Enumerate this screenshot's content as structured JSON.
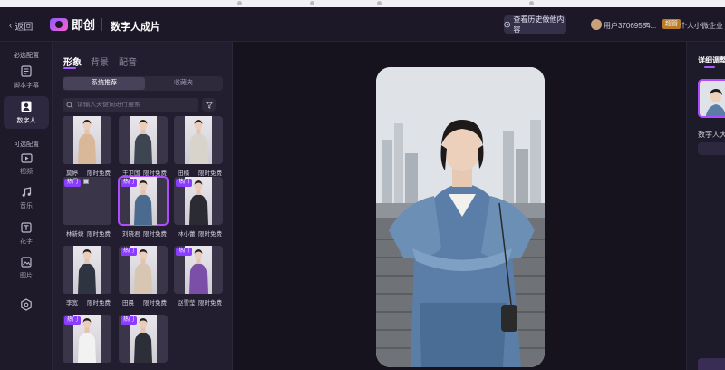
{
  "header": {
    "back_label": "返回",
    "logo_text": "即创",
    "page_title": "数字人成片",
    "history_button": "查看历史做他内容",
    "user_name": "用户37069584...",
    "vip_badge": "超管",
    "org_name": "个人小微企业"
  },
  "rail": {
    "section_required": "必选配置",
    "section_optional": "可选配置",
    "items": [
      {
        "label": "脚本字幕",
        "icon": "document-icon"
      },
      {
        "label": "数字人",
        "icon": "person-icon",
        "active": true
      },
      {
        "label": "视频",
        "icon": "video-icon"
      },
      {
        "label": "音乐",
        "icon": "music-icon"
      },
      {
        "label": "花字",
        "icon": "text-icon"
      },
      {
        "label": "图片",
        "icon": "image-icon"
      },
      {
        "label": "",
        "icon": "settings-hex-icon"
      }
    ]
  },
  "panel": {
    "tabs": [
      {
        "label": "形象",
        "active": true
      },
      {
        "label": "背景"
      },
      {
        "label": "配音"
      }
    ],
    "segments": [
      {
        "label": "系统推荐",
        "active": true
      },
      {
        "label": "收藏夹"
      }
    ],
    "search_placeholder": "请输入关键词进行搜索",
    "hot_badge": "热门",
    "cards": [
      {
        "name": "莫婷",
        "tag": "限时免费",
        "hot": false,
        "outfit": "#d9b89a"
      },
      {
        "name": "王卫国",
        "tag": "限时免费",
        "hot": false,
        "outfit": "#3d4552"
      },
      {
        "name": "田楠",
        "tag": "限时免费",
        "hot": false,
        "outfit": "#d8d3cb"
      },
      {
        "name": "林新婕",
        "tag": "限时免费",
        "hot": true,
        "broken": true
      },
      {
        "name": "刘晓君",
        "tag": "限时免费",
        "hot": true,
        "selected": true,
        "outfit": "#4b6a8f"
      },
      {
        "name": "林小蕾",
        "tag": "限时免费",
        "hot": true,
        "outfit": "#2b2b33"
      },
      {
        "name": "李宽",
        "tag": "限时免费",
        "hot": false,
        "outfit": "#2e3440"
      },
      {
        "name": "田晨",
        "tag": "限时免费",
        "hot": true,
        "outfit": "#d7c6b1"
      },
      {
        "name": "赵雪莹",
        "tag": "限时免费",
        "hot": true,
        "outfit": "#7b4fa8"
      },
      {
        "name": "",
        "tag": "",
        "hot": true,
        "outfit": "#f2f2f2"
      },
      {
        "name": "",
        "tag": "",
        "hot": true,
        "outfit": "#2d2f38"
      }
    ]
  },
  "right": {
    "title": "详细调整",
    "size_label": "数字人大小"
  },
  "colors": {
    "accent": "#b04cff",
    "bg": "#1a1625",
    "panel": "#221e30"
  }
}
